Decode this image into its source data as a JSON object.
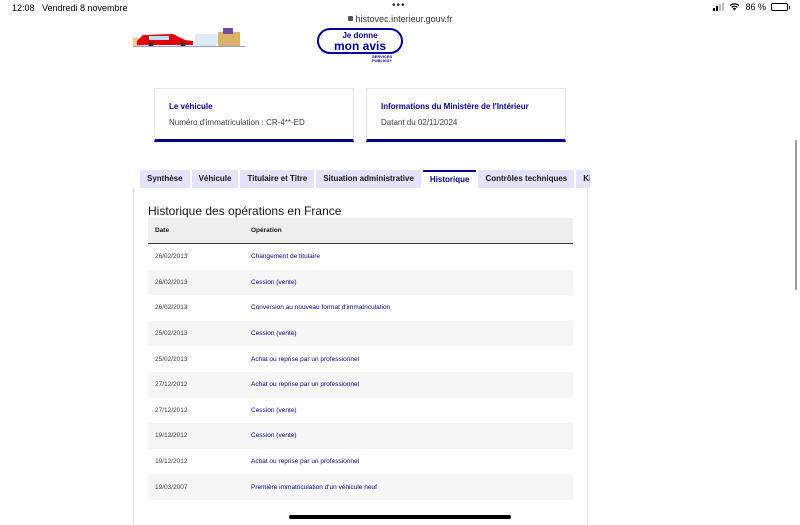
{
  "status_bar": {
    "time": "12:08",
    "date": "Vendredi 8 novembre",
    "battery": "86 %",
    "battery_level": 0.86
  },
  "browser": {
    "url": "histovec.interieur.gouv.fr"
  },
  "header": {
    "feedback_line1": "Je donne",
    "feedback_line2": "mon avis",
    "services_publics": "SERVICES PUBLICS+"
  },
  "vehicle_card": {
    "title": "Le véhicule",
    "subtitle": "Numéro d'immatriculation : CR-4**-ED"
  },
  "ministry_card": {
    "title": "Informations du Ministère de l'Intérieur",
    "subtitle": "Datant du 02/11/2024"
  },
  "tabs": [
    {
      "label": "Synthèse",
      "active": false
    },
    {
      "label": "Véhicule",
      "active": false
    },
    {
      "label": "Titulaire et Titre",
      "active": false
    },
    {
      "label": "Situation administrative",
      "active": false
    },
    {
      "label": "Historique",
      "active": true
    },
    {
      "label": "Contrôles techniques",
      "active": false
    },
    {
      "label": "Kilo",
      "active": false
    }
  ],
  "history": {
    "title": "Historique des opérations en France",
    "columns": {
      "date": "Date",
      "operation": "Opération"
    },
    "rows": [
      {
        "date": "26/02/2013",
        "operation": "Changement de titulaire"
      },
      {
        "date": "26/02/2013",
        "operation": "Cession (vente)"
      },
      {
        "date": "26/02/2013",
        "operation": "Conversion au nouveau format d'immatriculation"
      },
      {
        "date": "25/02/2013",
        "operation": "Cession (vente)"
      },
      {
        "date": "25/02/2013",
        "operation": "Achat ou reprise par un professionnel"
      },
      {
        "date": "27/12/2012",
        "operation": "Achat ou reprise par un professionnel"
      },
      {
        "date": "27/12/2012",
        "operation": "Cession (vente)"
      },
      {
        "date": "19/12/2012",
        "operation": "Cession (vente)"
      },
      {
        "date": "19/12/2012",
        "operation": "Achat ou reprise par un professionnel"
      },
      {
        "date": "19/03/2007",
        "operation": "Première immatriculation d'un véhicule neuf"
      }
    ]
  },
  "colors": {
    "brand_blue": "#000091",
    "tab_bg": "#e3e3fd"
  }
}
